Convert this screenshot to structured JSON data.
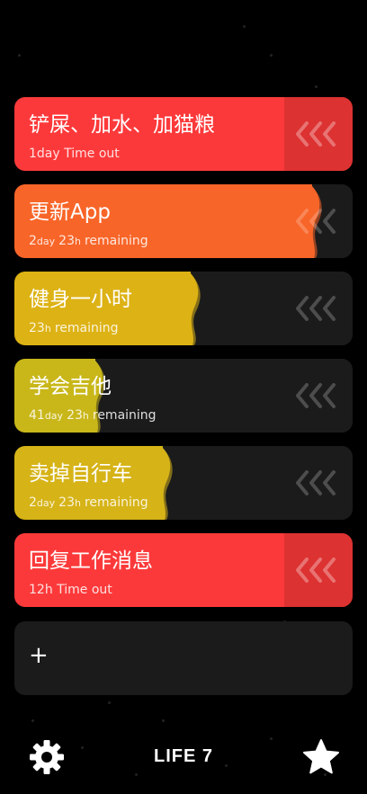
{
  "tasks": [
    {
      "title": "铲屎、加水、加猫粮",
      "sub": [
        {
          "t": "1day Time out",
          "c": "big"
        }
      ],
      "color": "#fc393a",
      "progress": 1.0,
      "state": "timeout"
    },
    {
      "title": "更新App",
      "sub": [
        {
          "t": "2",
          "c": "big"
        },
        {
          "t": "day",
          "c": "small"
        },
        {
          "t": "23",
          "c": "big"
        },
        {
          "t": "h",
          "c": "small"
        },
        {
          "t": "remaining",
          "c": "big"
        }
      ],
      "color": "#f86528",
      "progress": 0.88,
      "state": "remaining"
    },
    {
      "title": "健身一小时",
      "sub": [
        {
          "t": "23",
          "c": "big"
        },
        {
          "t": "h",
          "c": "small"
        },
        {
          "t": "remaining",
          "c": "big"
        }
      ],
      "color": "#ddb215",
      "progress": 0.52,
      "state": "remaining"
    },
    {
      "title": "学会吉他",
      "sub": [
        {
          "t": "41",
          "c": "big"
        },
        {
          "t": "day",
          "c": "small"
        },
        {
          "t": "23",
          "c": "big"
        },
        {
          "t": "h",
          "c": "small"
        },
        {
          "t": "remaining",
          "c": "big"
        }
      ],
      "color": "#c9b71a",
      "progress": 0.24,
      "state": "remaining"
    },
    {
      "title": "卖掉自行车",
      "sub": [
        {
          "t": "2",
          "c": "big"
        },
        {
          "t": "day",
          "c": "small"
        },
        {
          "t": "23",
          "c": "big"
        },
        {
          "t": "h",
          "c": "small"
        },
        {
          "t": "remaining",
          "c": "big"
        }
      ],
      "color": "#d6b317",
      "progress": 0.44,
      "state": "remaining"
    },
    {
      "title": "回复工作消息",
      "sub": [
        {
          "t": "12h Time out",
          "c": "big"
        }
      ],
      "color": "#fc393a",
      "progress": 1.0,
      "state": "timeout"
    }
  ],
  "add_task": {
    "label": "+"
  },
  "footer": {
    "life_label": "LIFE 7"
  },
  "icons": {
    "settings": "gear-icon",
    "favorites": "star-icon",
    "handle": "triple-chevron-left-icon"
  },
  "colors": {
    "card_bg": "#1b1b1b",
    "background": "#000000"
  }
}
